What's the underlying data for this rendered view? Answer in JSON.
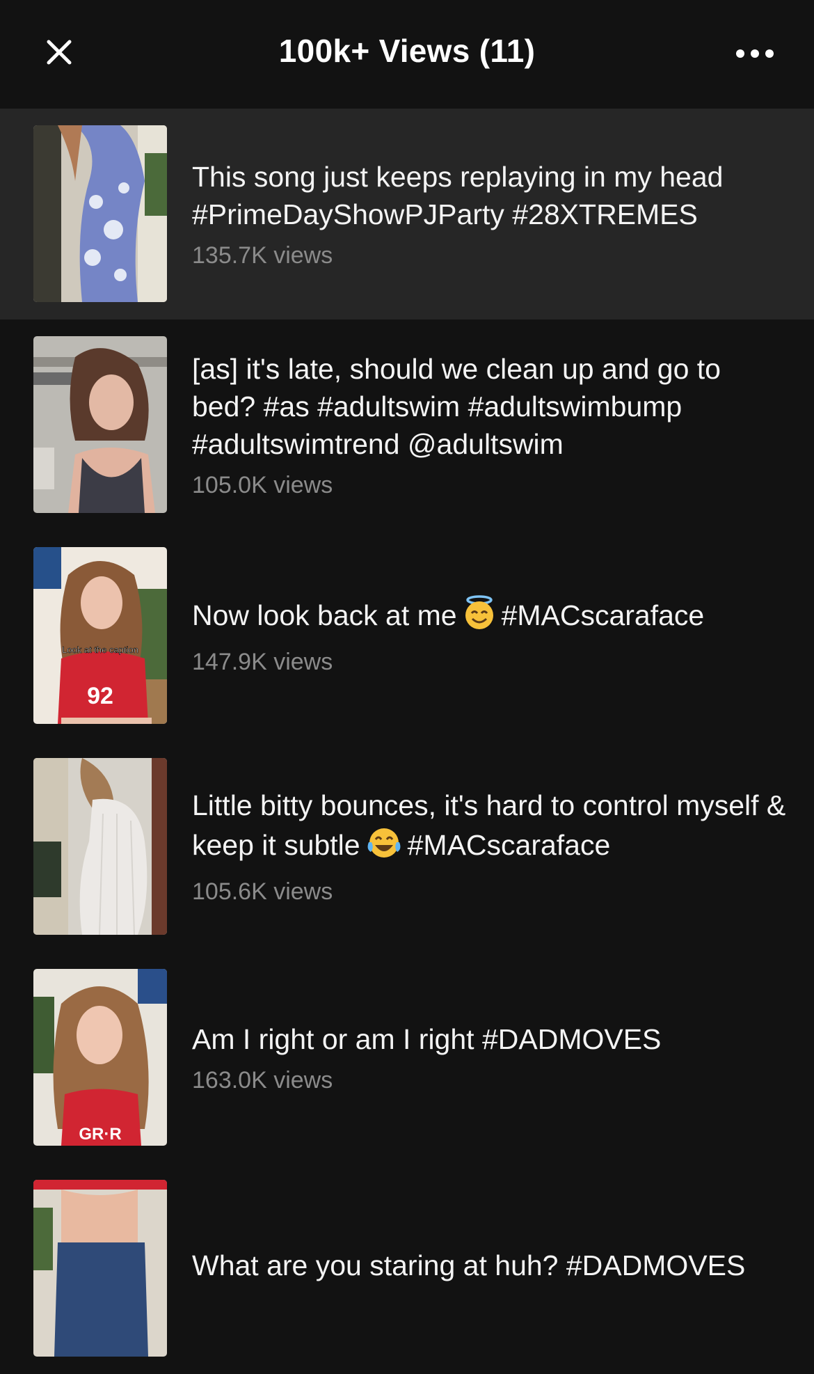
{
  "header": {
    "title": "100k+ Views (11)",
    "close_icon": "close-icon",
    "more_icon": "more-horizontal-icon"
  },
  "items": [
    {
      "caption_parts": [
        "This song just keeps replaying in my head #PrimeDayShowPJParty #28XTREMES"
      ],
      "views": "135.7K views",
      "highlighted": true
    },
    {
      "caption_parts": [
        "[as] it's late, should we clean up and go to bed? #as #adultswim #adultswimbump #adultswimtrend  @adultswim"
      ],
      "views": "105.0K views"
    },
    {
      "caption_parts": [
        "Now look back at me",
        "#MACscaraface"
      ],
      "emoji": "smiling-face-with-halo",
      "views": "147.9K views",
      "thumb_text": "Look at the caption"
    },
    {
      "caption_parts": [
        "Little bitty bounces, it's hard to control myself & keep it subtle",
        "#MACscaraface"
      ],
      "emoji": "face-with-tears-of-joy",
      "views": "105.6K views"
    },
    {
      "caption_parts": [
        "Am I right or am I right #DADMOVES"
      ],
      "views": "163.0K views"
    },
    {
      "caption_parts": [
        "What are you staring at huh? #DADMOVES"
      ],
      "views": ""
    }
  ],
  "colors": {
    "background": "#121212",
    "highlight_row": "#262626",
    "caption": "#f4f4f4",
    "views": "#8b8b8b"
  }
}
